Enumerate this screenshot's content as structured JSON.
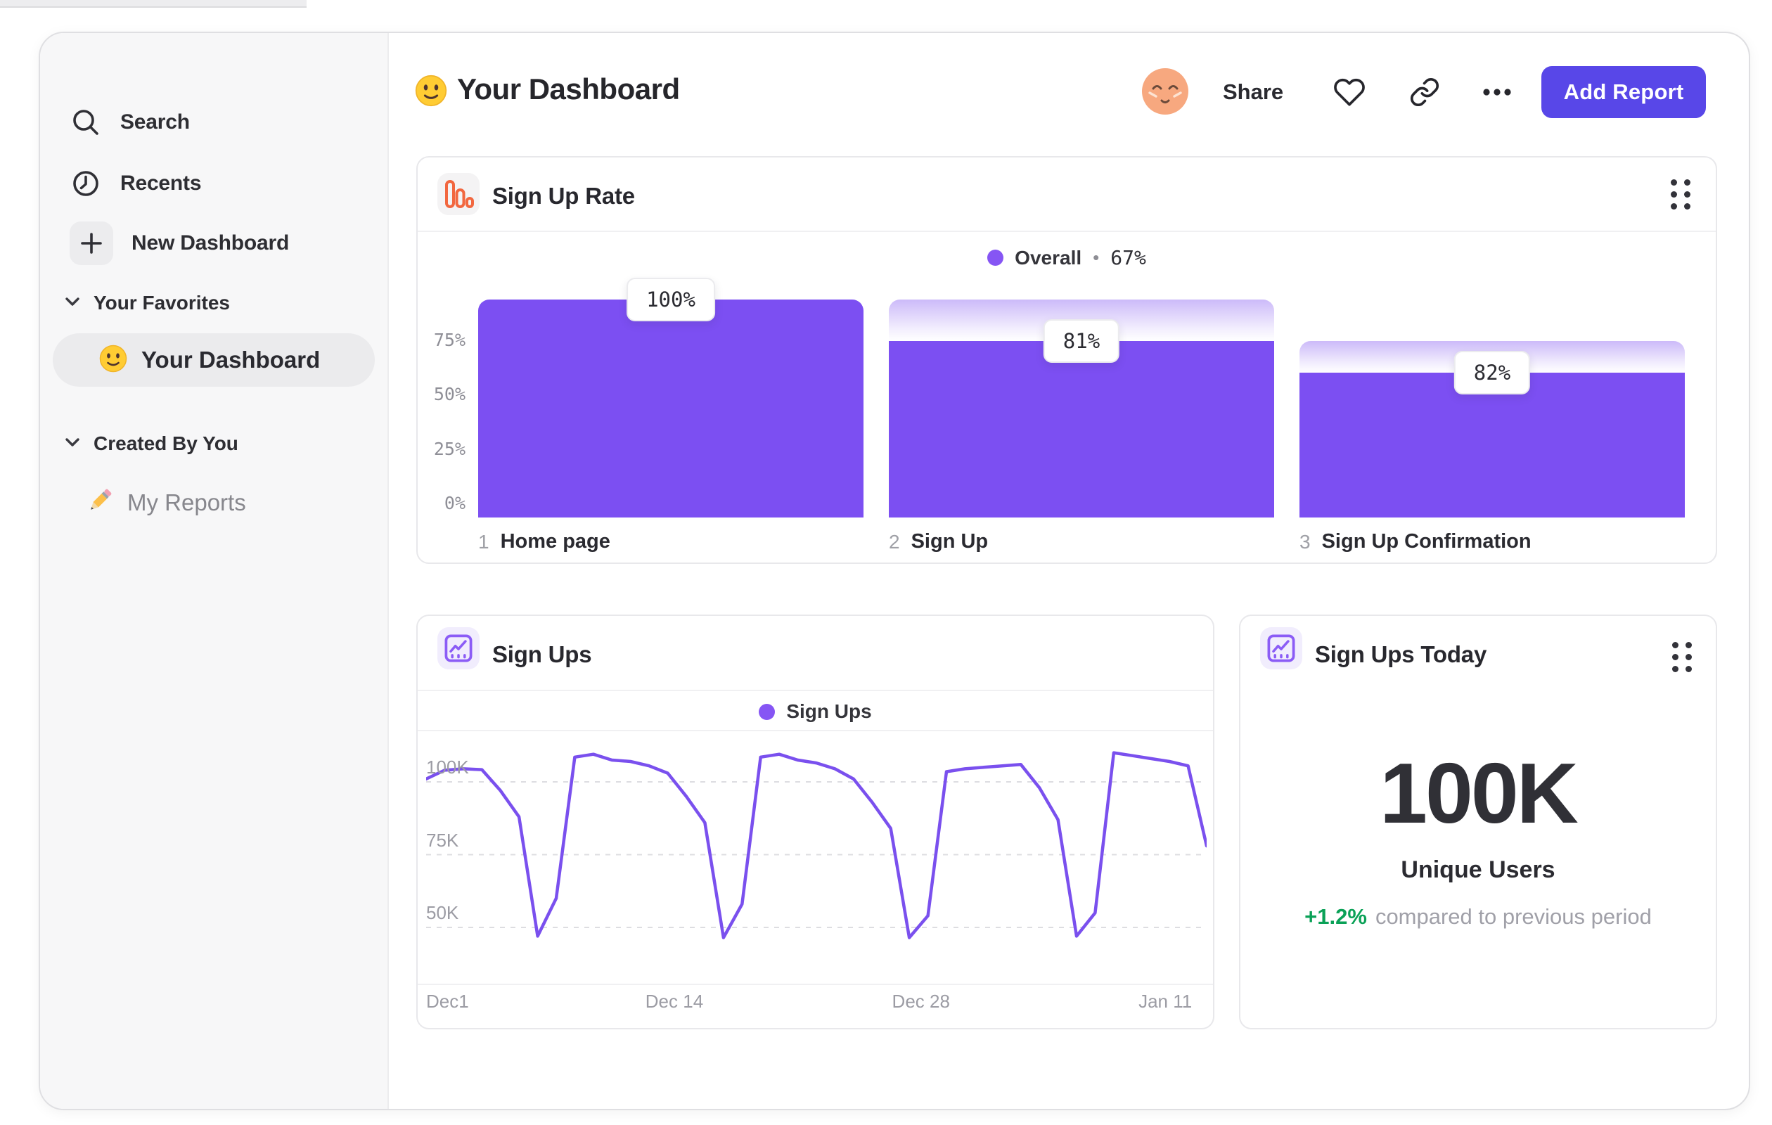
{
  "colors": {
    "accent_button": "#5847E8",
    "bar_purple": "#7C4FF2",
    "line_purple": "#7A50EE",
    "legend_dot": "#8655F4",
    "delta_green": "#0AA157",
    "icon_orange": "#F2673F",
    "icon_purple": "#8B5CF6",
    "avatar_peach": "#F7A87F"
  },
  "sidebar": {
    "items": [
      {
        "label": "Search",
        "icon": "search-icon"
      },
      {
        "label": "Recents",
        "icon": "clock-icon"
      },
      {
        "label": "New Dashboard",
        "icon": "plus-icon"
      }
    ],
    "sections": [
      {
        "title": "Your Favorites",
        "items": [
          {
            "label": "Your Dashboard",
            "icon": "smiley-emoji",
            "active": true
          }
        ]
      },
      {
        "title": "Created By You",
        "items": [
          {
            "label": "My Reports",
            "icon": "pencil-emoji",
            "active": false
          }
        ]
      }
    ]
  },
  "header": {
    "emoji": "smiley-emoji",
    "title": "Your Dashboard",
    "share": "Share",
    "add_report": "Add Report"
  },
  "cards": {
    "funnel": {
      "title": "Sign Up Rate"
    },
    "line": {
      "title": "Sign Ups"
    },
    "stat": {
      "title": "Sign Ups Today",
      "value": "100K",
      "unit_label": "Unique Users",
      "delta": "+1.2%",
      "delta_caption": "compared to previous period"
    }
  },
  "chart_data": [
    {
      "type": "bar",
      "subtype": "funnel",
      "title": "Sign Up Rate",
      "legend": {
        "name": "Overall",
        "separator": "•",
        "value": "67%"
      },
      "steps": [
        {
          "number": "1",
          "label": "Home page",
          "conversion_label": "100%",
          "absolute_pct": 100,
          "ghost_pct": null
        },
        {
          "number": "2",
          "label": "Sign Up",
          "conversion_label": "81%",
          "absolute_pct": 81,
          "ghost_pct": 100
        },
        {
          "number": "3",
          "label": "Sign Up Confirmation",
          "conversion_label": "82%",
          "absolute_pct": 66.4,
          "ghost_pct": 81
        }
      ],
      "y_ticks": [
        {
          "pct": 75,
          "label": "75%"
        },
        {
          "pct": 50,
          "label": "50%"
        },
        {
          "pct": 25,
          "label": "25%"
        },
        {
          "pct": 0,
          "label": "0%"
        }
      ],
      "ylim": [
        0,
        100
      ],
      "overall_conversion": "67%",
      "bar_color": "#7C4FF2",
      "note": "conversion_label is relative to previous step; ghost band shows previous step level"
    },
    {
      "type": "line",
      "title": "Sign Ups",
      "legend": {
        "name": "Sign Ups"
      },
      "x_tick_labels": [
        "Dec1",
        "Dec 14",
        "Dec 28",
        "Jan 11"
      ],
      "x_tick_fractions": [
        0,
        0.318,
        0.634,
        0.947
      ],
      "y_ticks": [
        {
          "value": 100,
          "label": "100K"
        },
        {
          "value": 75,
          "label": "75K"
        },
        {
          "value": 50,
          "label": "50K"
        }
      ],
      "ylim_k": [
        30.7,
        115.2
      ],
      "grid": "dashed-horizontal",
      "series": [
        {
          "name": "Sign Ups",
          "color": "#7A50EE",
          "values_k": [
            101,
            104,
            104.5,
            104.2,
            97,
            88,
            47,
            60,
            108.5,
            109.5,
            107.5,
            107,
            105.5,
            103,
            95,
            86,
            46.5,
            58,
            108.5,
            109.5,
            107.5,
            106.5,
            104.5,
            101,
            93,
            84,
            46.5,
            54,
            103.5,
            104.5,
            105,
            105.5,
            106,
            98,
            87,
            47,
            55,
            110,
            109,
            108,
            107,
            105.5,
            78
          ]
        }
      ]
    }
  ]
}
